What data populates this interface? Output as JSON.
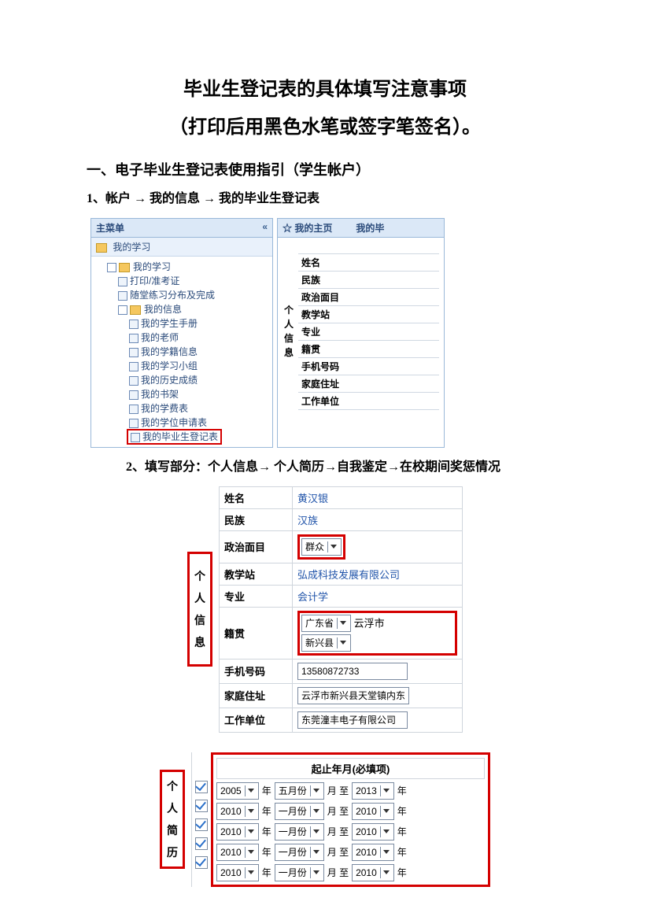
{
  "title1": "毕业生登记表的具体填写注意事项",
  "title2": "（打印后用黑色水笔或签字笔签名）。",
  "heading1": "一、电子毕业生登记表使用指引（学生帐户）",
  "step1": "1、帐户 → 我的信息 → 我的毕业生登记表",
  "step2": "2、填写部分：个人信息→ 个人简历→自我鉴定→在校期间奖惩情况",
  "tree": {
    "header": "主菜单",
    "chev": "«",
    "section": "我的学习",
    "root": "我的学习",
    "items": [
      "打印/准考证",
      "随堂练习分布及完成",
      "我的信息",
      "我的学生手册",
      "我的老师",
      "我的学籍信息",
      "我的学习小组",
      "我的历史成绩",
      "我的书架",
      "我的学费表",
      "我的学位申请表",
      "我的毕业生登记表"
    ]
  },
  "formTabs": {
    "a": "☆ 我的主页",
    "b": "我的毕"
  },
  "vlabel_info": "个人信息",
  "form_labels": [
    "姓名",
    "民族",
    "政治面目",
    "教学站",
    "专业",
    "籍贯",
    "手机号码",
    "家庭住址",
    "工作单位"
  ],
  "info": {
    "name_label": "姓名",
    "name": "黄汉银",
    "nation_label": "民族",
    "nation": "汉族",
    "pol_label": "政治面目",
    "pol": "群众",
    "station_label": "教学站",
    "station": "弘成科技发展有限公司",
    "major_label": "专业",
    "major": "会计学",
    "origin_label": "籍贯",
    "prov": "广东省",
    "city": "云浮市",
    "county": "新兴县",
    "phone_label": "手机号码",
    "phone": "13580872733",
    "addr_label": "家庭住址",
    "addr": "云浮市新兴县天堂镇内东",
    "work_label": "工作单位",
    "work": "东莞潼丰电子有限公司"
  },
  "vlabel_resume": "个人简历",
  "resume_head": "起止年月(必填项)",
  "resume": [
    {
      "fy": "2005",
      "fm": "五月份",
      "ty": "2013"
    },
    {
      "fy": "2010",
      "fm": "一月份",
      "ty": "2010"
    },
    {
      "fy": "2010",
      "fm": "一月份",
      "ty": "2010"
    },
    {
      "fy": "2010",
      "fm": "一月份",
      "ty": "2010"
    },
    {
      "fy": "2010",
      "fm": "一月份",
      "ty": "2010"
    }
  ],
  "unit": {
    "year": "年",
    "month": "月",
    "to": "至"
  }
}
